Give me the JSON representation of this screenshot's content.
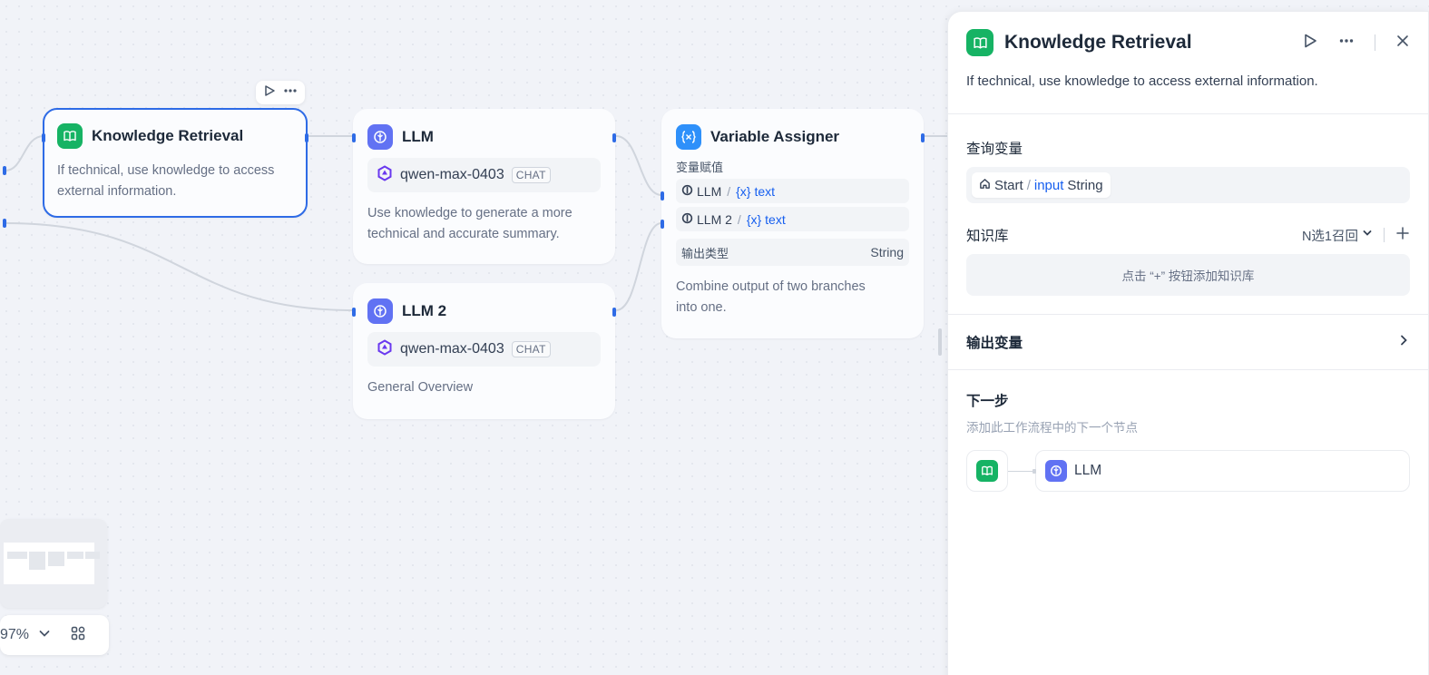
{
  "colors": {
    "accent": "#2e6be6",
    "knowledge_icon": "#16b364",
    "llm_icon": "#6172f3",
    "assigner_icon": "#2e90fa",
    "variable_link": "#155eef"
  },
  "canvas": {
    "knowledge_node": {
      "title": "Knowledge Retrieval",
      "description_line1": "If technical, use knowledge to access",
      "description_line2": "external information.",
      "icon": "book-icon"
    },
    "llm_node": {
      "title": "LLM",
      "model": "qwen-max-0403",
      "mode_badge": "CHAT",
      "description_line1": "Use knowledge to generate a more",
      "description_line2": "technical and accurate summary.",
      "icon": "brain-icon"
    },
    "llm2_node": {
      "title": "LLM 2",
      "model": "qwen-max-0403",
      "mode_badge": "CHAT",
      "description": "General Overview",
      "icon": "brain-icon"
    },
    "assigner_node": {
      "title": "Variable Assigner",
      "section_label": "变量赋值",
      "rows": [
        {
          "source": "LLM",
          "var": "text"
        },
        {
          "source": "LLM 2",
          "var": "text"
        }
      ],
      "output_type_label": "输出类型",
      "output_type_value": "String",
      "description_line1": "Combine output of two branches",
      "description_line2": "into one.",
      "icon": "variable-icon"
    },
    "zoom_level": "97%"
  },
  "panel": {
    "title": "Knowledge Retrieval",
    "description": "If technical, use knowledge to access external information.",
    "query_variable": {
      "label": "查询变量",
      "node": "Start",
      "name": "input",
      "type": "String"
    },
    "knowledge_base": {
      "label": "知识库",
      "mode": "N选1召回",
      "empty_hint": "点击 “+” 按钮添加知识库"
    },
    "output_variables": {
      "label": "输出变量"
    },
    "next_step": {
      "label": "下一步",
      "hint": "添加此工作流程中的下一个节点",
      "target": "LLM"
    }
  }
}
